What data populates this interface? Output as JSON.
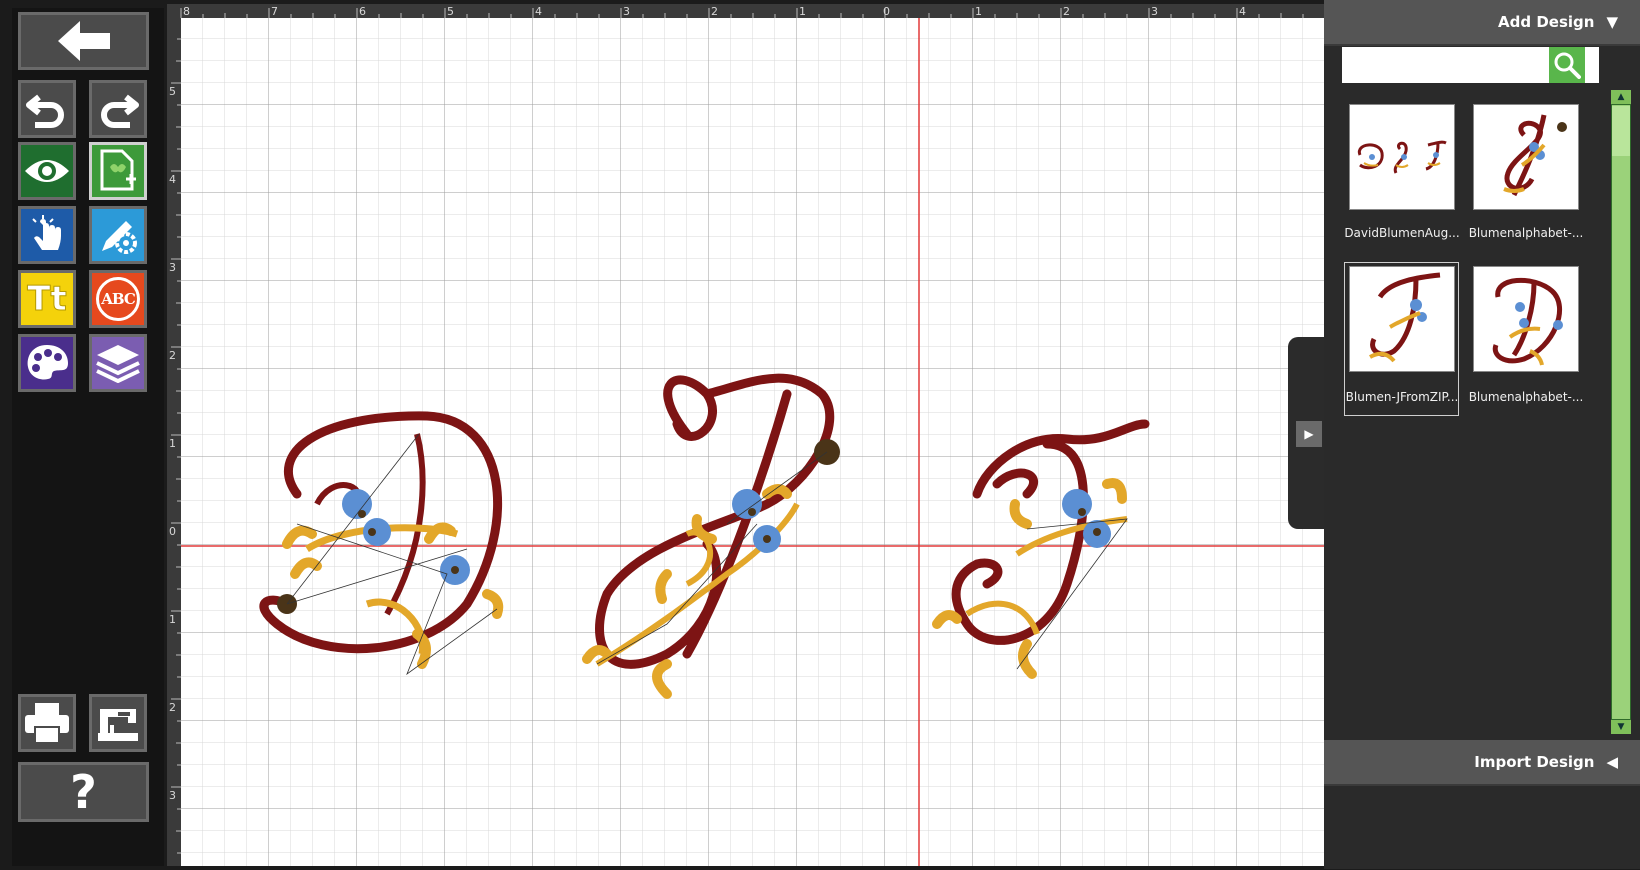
{
  "toolbar": {
    "colors": {
      "frame": "#6a6a6a",
      "gray": "#4b4b4b",
      "green": "#1f6e2f",
      "blue": "#1e5ba8",
      "lightblue": "#2c9ad8",
      "yellow": "#f4d20b",
      "orange": "#e6491e",
      "purple": "#4a2e8c",
      "violet": "#7b5db1"
    },
    "text_icon_label": "Tt",
    "monogram_label": "ABC",
    "help_label": "?"
  },
  "ruler": {
    "top_labels": [
      "8",
      "7",
      "6",
      "5",
      "4",
      "3",
      "2",
      "1",
      "0",
      "1",
      "2",
      "3",
      "4"
    ],
    "left_labels": [
      "5",
      "4",
      "3",
      "2",
      "1",
      "0",
      "1",
      "2",
      "3"
    ]
  },
  "panel": {
    "add_design_label": "Add Design",
    "import_design_label": "Import Design",
    "search_value": "",
    "designs": [
      {
        "label": "DavidBlumenAug..."
      },
      {
        "label": "Blumenalphabet-..."
      },
      {
        "label": "Blumen-JFromZIP..."
      },
      {
        "label": "Blumenalphabet-..."
      }
    ]
  },
  "embroidery": {
    "thread_colors": {
      "red": "#7d1414",
      "gold": "#e3a72a",
      "blue": "#5b8fd3",
      "dark": "#4a3418"
    },
    "letters": [
      "D",
      "S",
      "J"
    ]
  }
}
